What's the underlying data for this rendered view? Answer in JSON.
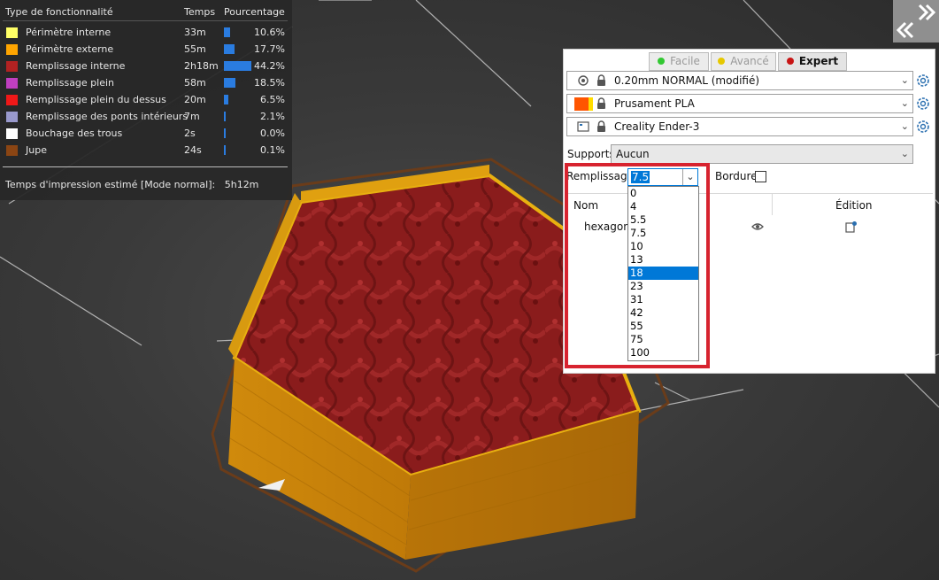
{
  "legend": {
    "headers": {
      "feature": "Type de fonctionnalité",
      "time": "Temps",
      "percent": "Pourcentage"
    },
    "rows": [
      {
        "label": "Périmètre interne",
        "time": "33m",
        "percent": "10.6%",
        "fraction": 0.106,
        "color": "#ffff66"
      },
      {
        "label": "Périmètre externe",
        "time": "55m",
        "percent": "17.7%",
        "fraction": 0.177,
        "color": "#ffa500"
      },
      {
        "label": "Remplissage interne",
        "time": "2h18m",
        "percent": "44.2%",
        "fraction": 0.442,
        "color": "#b22222"
      },
      {
        "label": "Remplissage plein",
        "time": "58m",
        "percent": "18.5%",
        "fraction": 0.185,
        "color": "#c03fc0"
      },
      {
        "label": "Remplissage plein du dessus",
        "time": "20m",
        "percent": "6.5%",
        "fraction": 0.065,
        "color": "#f01818"
      },
      {
        "label": "Remplissage des ponts intérieurs",
        "time": "7m",
        "percent": "2.1%",
        "fraction": 0.021,
        "color": "#9999cc"
      },
      {
        "label": "Bouchage des trous",
        "time": "2s",
        "percent": "0.0%",
        "fraction": 0.0,
        "color": "#ffffff"
      },
      {
        "label": "Jupe",
        "time": "24s",
        "percent": "0.1%",
        "fraction": 0.001,
        "color": "#8b4513"
      }
    ],
    "estimate_label": "Temps d'impression estimé [Mode normal]:",
    "estimate_value": "5h12m"
  },
  "collapse_button": {
    "icon": "double-chevron-icon"
  },
  "modes": [
    {
      "label": "Facile",
      "color": "#32c832",
      "active": false
    },
    {
      "label": "Avancé",
      "color": "#e6c800",
      "active": false
    },
    {
      "label": "Expert",
      "color": "#c81414",
      "active": true
    }
  ],
  "presets": {
    "print": "0.20mm NORMAL (modifié)",
    "filament": "Prusament PLA",
    "printer": "Creality Ender-3"
  },
  "filament_colors": [
    "#ff5500",
    "#ffdd00"
  ],
  "supports": {
    "label": "Supports:",
    "value": "Aucun"
  },
  "infill": {
    "label": "Remplissage:",
    "value": "7.5",
    "options": [
      "0",
      "4",
      "5.5",
      "7.5",
      "10",
      "13",
      "18",
      "23",
      "31",
      "42",
      "55",
      "75",
      "100"
    ],
    "highlighted": "18"
  },
  "brim": {
    "label": "Bordure:",
    "checked": false
  },
  "object_list": {
    "col_name": "Nom",
    "col_edit": "Édition",
    "objects": [
      {
        "name": "hexagon."
      }
    ]
  }
}
